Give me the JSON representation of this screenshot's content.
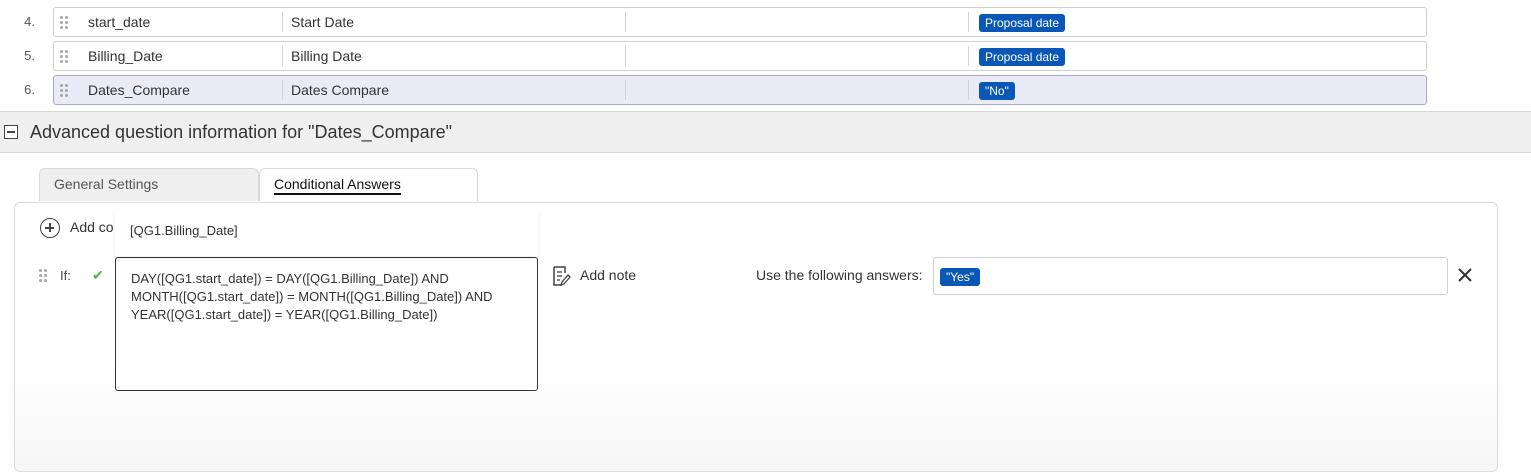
{
  "questions": [
    {
      "num": "4.",
      "field": "start_date",
      "label": "Start Date",
      "extra": "",
      "default_answer": "Proposal date",
      "selected": false
    },
    {
      "num": "5.",
      "field": "Billing_Date",
      "label": "Billing Date",
      "extra": "",
      "default_answer": "Proposal date",
      "selected": false
    },
    {
      "num": "6.",
      "field": "Dates_Compare",
      "label": "Dates Compare",
      "extra": "",
      "default_answer": "\"No\"",
      "selected": true
    }
  ],
  "advanced": {
    "title": "Advanced question information for \"Dates_Compare\""
  },
  "tabs": {
    "general": "General Settings",
    "conditional": "Conditional Answers"
  },
  "conditional": {
    "add_label": "Add co",
    "suggestion": "[QG1.Billing_Date]",
    "if_label": "If:",
    "condition_text": "DAY([QG1.start_date]) = DAY([QG1.Billing_Date]) AND\nMONTH([QG1.start_date]) = MONTH([QG1.Billing_Date]) AND\nYEAR([QG1.start_date]) = YEAR([QG1.Billing_Date])",
    "add_note": "Add note",
    "answers_label": "Use the following answers:",
    "answer_badge": "\"Yes\""
  },
  "icons": {
    "collapse": "minus-square-icon",
    "add": "plus-circle-icon",
    "check": "check-icon",
    "note": "note-icon",
    "remove": "close-icon",
    "drag": "drag-handle-icon"
  },
  "colors": {
    "badge": "#0b57b8",
    "selected_row": "#ebebf7",
    "check": "#5aa854"
  }
}
